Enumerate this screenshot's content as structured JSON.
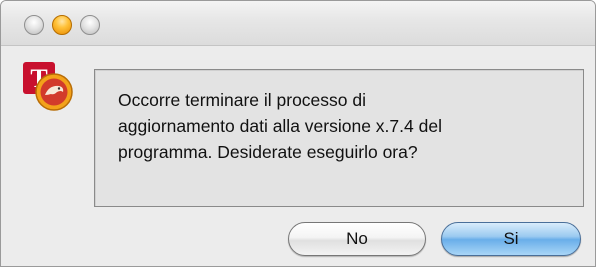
{
  "window": {
    "controls": [
      "close",
      "minimize",
      "zoom"
    ]
  },
  "app_icon": {
    "name": "app-icon",
    "letter": "T"
  },
  "dialog": {
    "message": "Occorre terminare il processo di\naggiornamento dati alla versione x.7.4 del\nprogramma. Desiderate eseguirlo ora?"
  },
  "buttons": {
    "no_label": "No",
    "si_label": "Si"
  },
  "colors": {
    "minimize": "#ffc23a",
    "default_button": "#69aee9",
    "icon_red": "#c8102e"
  }
}
